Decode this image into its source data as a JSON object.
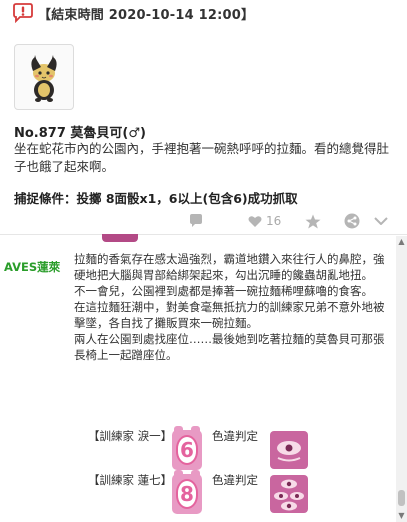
{
  "header": {
    "text": "【結束時間 2020-10-14 12:00】",
    "alert_icon": "alert-exclamation-icon",
    "accent": "#d63b3b"
  },
  "post": {
    "title": "No.877 莫魯貝可(♂)",
    "description": "坐在蛇花市內的公園內，手裡抱著一碗熱呼呼的拉麵。看的總覺得肚子也餓了起來啊。",
    "condition": "捕捉條件：投擲 8面骰x1，6以上(包含6)成功抓取",
    "thumbnail_icon": "morpeko-sprite-icon"
  },
  "actions": {
    "likes": "16",
    "icons": [
      "comment-icon",
      "heart-icon",
      "star-icon",
      "share-icon",
      "more-icon"
    ]
  },
  "comment": {
    "author": "AVES蓮萊",
    "author_color": "#2a9d2a",
    "paragraphs": [
      "拉麵的香氣存在感太過強烈，霸道地鑽入來往行人的鼻腔，強硬地把大腦與胃部給綁架起來，勾出沉睡的饞蟲胡亂地扭。",
      "不一會兒，公園裡到處都是捧著一碗拉麵稀哩蘇嚕的食客。",
      "在這拉麵狂潮中，對美食毫無抵抗力的訓練家兄弟不意外地被擊墜，各自找了攤販買來一碗拉麵。",
      "兩人在公園到處找座位……最後她到吃著拉麵的莫魯貝可那張長椅上一起蹭座位。"
    ],
    "rolls": [
      {
        "label": "【訓練家 淚一】",
        "value": "6",
        "suffix": "色違判定",
        "result_icon": "eye-result-icon"
      },
      {
        "label": "【訓練家 蓮七】",
        "value": "8",
        "suffix": "色違判定",
        "result_icon": "triple-eye-result-icon"
      }
    ],
    "die_color": "#e89ac4",
    "result_color": "#c9669f"
  }
}
